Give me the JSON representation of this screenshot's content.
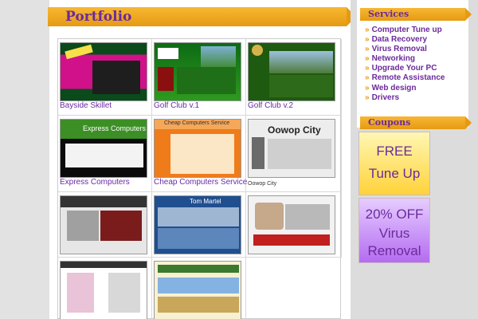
{
  "portfolio": {
    "title": "Portfolio",
    "items": [
      {
        "caption": "Bayside Skillet"
      },
      {
        "caption": "Golf Club v.1"
      },
      {
        "caption": "Golf Club v.2"
      },
      {
        "caption": "Express Computers"
      },
      {
        "caption": "Cheap Computers Service"
      },
      {
        "caption": "Oowop City"
      },
      {
        "caption": ""
      },
      {
        "caption": ""
      },
      {
        "caption": ""
      },
      {
        "caption": ""
      },
      {
        "caption": ""
      }
    ],
    "thumb_text": {
      "express": "Express Computers",
      "cheap": "Cheap Computers Service",
      "oowop": "Oowop City",
      "tom": "Tom Martel"
    }
  },
  "sidebar": {
    "services_title": "Services",
    "services": [
      "Computer Tune up",
      "Data Recovery",
      "Virus Removal",
      "Networking",
      "Upgrade Your PC",
      "Remote Assistance",
      "Web design",
      "Drivers"
    ],
    "coupons_title": "Coupons",
    "coupon1": {
      "line1": "FREE",
      "line2": "Tune Up"
    },
    "coupon2": {
      "line1": "20% OFF",
      "line2": "Virus",
      "line3": "Removal"
    }
  },
  "colors": {
    "accent": "#e89a12",
    "brand_purple": "#6b2a9b"
  }
}
